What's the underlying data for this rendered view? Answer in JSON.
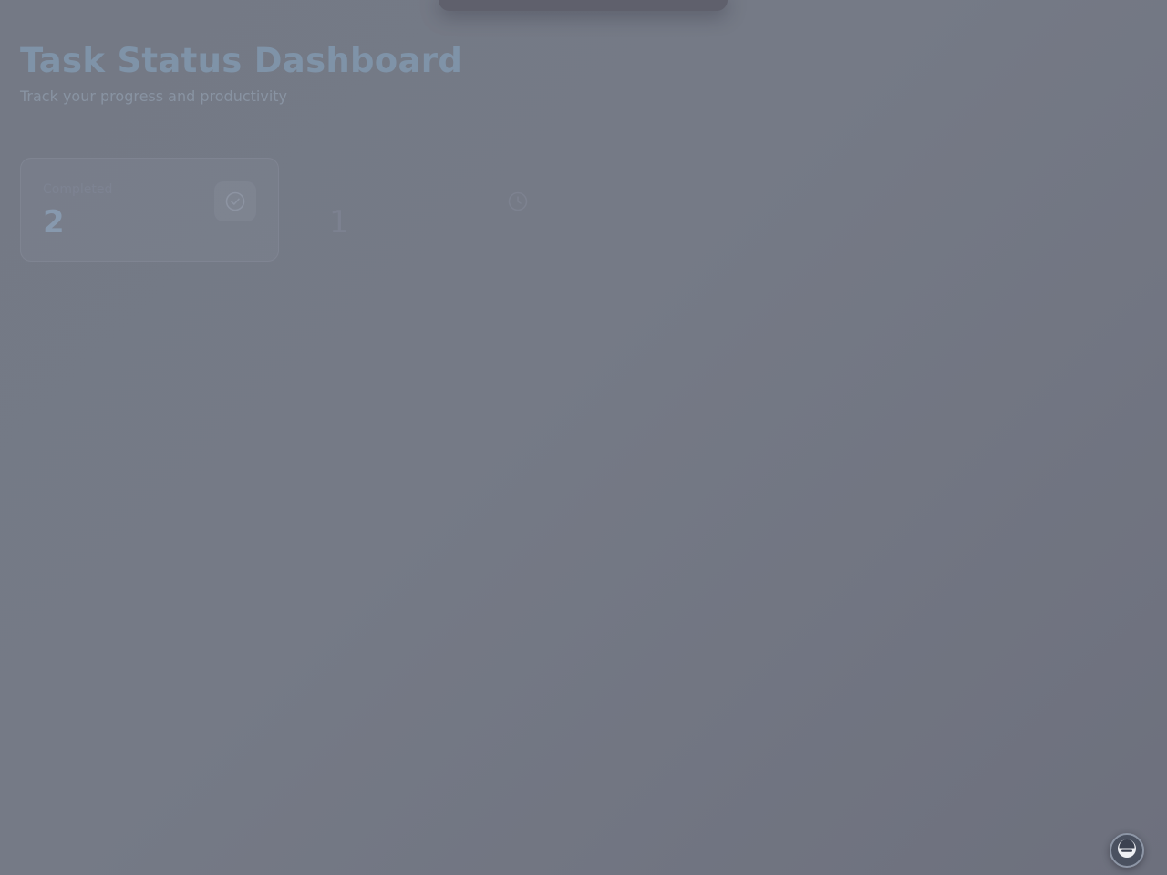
{
  "header": {
    "title": "Task Status Dashboard",
    "subtitle": "Track your progress and productivity"
  },
  "stats": [
    {
      "label": "Completed",
      "value": "2",
      "icon": "check-circle-icon"
    },
    {
      "label": "",
      "value": "1",
      "icon": "clock-icon"
    }
  ],
  "assistant_button": {
    "icon": "assistant-icon"
  },
  "colors": {
    "overlay": "#747985",
    "title": "#7f93a8",
    "accent": "#8799ae"
  }
}
